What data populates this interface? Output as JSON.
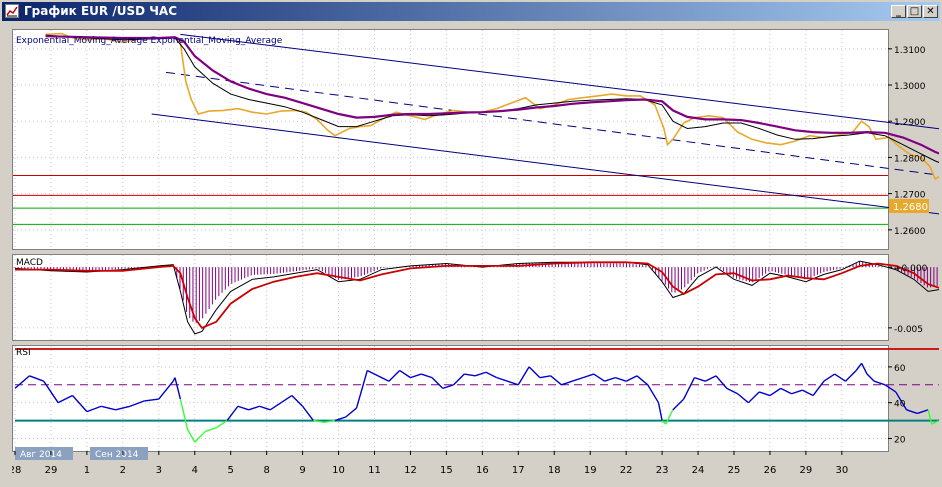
{
  "window": {
    "title": "График EUR /USD  ЧАС",
    "buttons": {
      "minimize": "_",
      "restore": "□",
      "close": "✕"
    }
  },
  "colors": {
    "price": "#e8a82c",
    "ema_fast": "#000000",
    "ema_slow": "#800080",
    "channel": "#000080",
    "resistance": "#cc0000",
    "support": "#00aa00",
    "macd_line": "#000000",
    "macd_signal": "#cc0000",
    "macd_hist": "#800080",
    "rsi_line": "#0000cc",
    "rsi_oversold": "#33ff33",
    "rsi_upper": "#cc0000",
    "rsi_mid": "#800080",
    "rsi_lower": "#008080",
    "price_tag": "#e8a82c"
  },
  "chart_data": [
    {
      "type": "line",
      "panel": "main",
      "title": "Exponential_Moving_Average Exponential_Moving_Average",
      "xlabel": "",
      "ylabel": "",
      "ylim": [
        1.2547,
        1.3152
      ],
      "yticks": [
        "1.3100",
        "1.3000",
        "1.2900",
        "1.2800",
        "1.2700",
        "1.2600"
      ],
      "current_price_label": "1.2680",
      "horizontal_levels": [
        {
          "kind": "resistance",
          "value": 1.275
        },
        {
          "kind": "resistance",
          "value": 1.2695
        },
        {
          "kind": "support",
          "value": 1.266
        },
        {
          "kind": "support",
          "value": 1.2615
        }
      ],
      "channel_lines": [
        {
          "kind": "upper",
          "from": [
            4.6,
            1.314
          ],
          "to": [
            30.5,
            1.282
          ]
        },
        {
          "kind": "middle",
          "from": [
            4.2,
            1.3035
          ],
          "to": [
            30.7,
            1.2685
          ]
        },
        {
          "kind": "lower",
          "from": [
            3.8,
            1.292
          ],
          "to": [
            30.0,
            1.259
          ]
        }
      ],
      "series": [
        {
          "role": "price",
          "x": [
            0.85,
            1.3,
            1.6,
            2,
            2.5,
            3,
            3.5,
            3.9,
            4.1,
            4.45,
            4.6,
            4.65,
            4.75,
            4.9,
            5.1,
            5.4,
            5.8,
            6.2,
            6.6,
            7,
            7.4,
            7.8,
            8.1,
            8.4,
            8.7,
            8.9,
            9.1,
            9.3,
            9.6,
            9.9,
            10.2,
            10.6,
            11,
            11.4,
            11.8,
            12.2,
            12.6,
            13,
            13.4,
            13.8,
            14.2,
            14.6,
            15,
            15.4,
            15.8,
            16.2,
            16.6,
            17,
            17.4,
            17.8,
            18.05,
            18.15,
            18.3,
            18.6,
            18.9,
            19.3,
            19.7,
            20.1,
            20.5,
            20.9,
            21.3,
            21.7,
            22.1,
            22.5,
            22.9,
            23.3,
            23.55,
            23.75,
            23.95,
            24.3,
            24.6,
            24.9,
            25.2,
            25.45,
            25.6,
            25.8,
            26.1,
            26.4,
            26.7,
            26.95,
            27.2,
            27.45,
            27.6
          ],
          "y": [
            1.314,
            1.3142,
            1.313,
            1.3125,
            1.3128,
            1.3118,
            1.3128,
            1.313,
            1.313,
            1.3132,
            1.312,
            1.308,
            1.301,
            1.296,
            1.292,
            1.2928,
            1.293,
            1.2935,
            1.2925,
            1.292,
            1.2928,
            1.293,
            1.2925,
            1.2905,
            1.2875,
            1.286,
            1.287,
            1.288,
            1.2885,
            1.2888,
            1.2905,
            1.2925,
            1.2915,
            1.2905,
            1.292,
            1.293,
            1.2925,
            1.2925,
            1.2935,
            1.295,
            1.2965,
            1.2935,
            1.2945,
            1.296,
            1.2965,
            1.297,
            1.2975,
            1.297,
            1.297,
            1.2945,
            1.288,
            1.2835,
            1.285,
            1.2895,
            1.291,
            1.2915,
            1.291,
            1.287,
            1.285,
            1.284,
            1.2835,
            1.2845,
            1.286,
            1.2855,
            1.2862,
            1.287,
            1.29,
            1.2885,
            1.285,
            1.2855,
            1.283,
            1.2808,
            1.28,
            1.2775,
            1.274,
            1.2755,
            1.276,
            1.2765,
            1.276,
            1.273,
            1.2698,
            1.2688,
            1.269
          ]
        },
        {
          "role": "ema_fast",
          "x": [
            0.85,
            2,
            3,
            4,
            4.45,
            4.7,
            5,
            5.5,
            6,
            6.5,
            7,
            7.5,
            8,
            8.5,
            9,
            9.5,
            10,
            10.5,
            11,
            11.5,
            12,
            12.5,
            13,
            13.5,
            14,
            14.5,
            15,
            15.5,
            16,
            16.5,
            17,
            17.5,
            18,
            18.3,
            18.7,
            19.2,
            19.7,
            20.2,
            20.7,
            21.2,
            21.7,
            22.2,
            22.7,
            23.2,
            23.7,
            24.2,
            24.7,
            25.2,
            25.6,
            26,
            26.4,
            26.8,
            27.2,
            27.6
          ],
          "y": [
            1.3138,
            1.313,
            1.3125,
            1.3128,
            1.313,
            1.31,
            1.305,
            1.3005,
            1.2975,
            1.296,
            1.295,
            1.294,
            1.2925,
            1.2905,
            1.2885,
            1.2885,
            1.29,
            1.2915,
            1.2918,
            1.2915,
            1.2918,
            1.2922,
            1.2925,
            1.2928,
            1.2935,
            1.2945,
            1.295,
            1.2955,
            1.2958,
            1.296,
            1.2962,
            1.296,
            1.2945,
            1.29,
            1.288,
            1.2885,
            1.2895,
            1.2895,
            1.288,
            1.2862,
            1.285,
            1.2852,
            1.2858,
            1.2862,
            1.2868,
            1.286,
            1.2835,
            1.281,
            1.279,
            1.2775,
            1.2768,
            1.2762,
            1.274,
            1.2712
          ]
        },
        {
          "role": "ema_slow",
          "x": [
            0.85,
            2,
            3,
            4,
            4.45,
            4.7,
            5,
            5.5,
            6,
            6.5,
            7,
            7.5,
            8,
            8.5,
            9,
            9.5,
            10,
            10.5,
            11,
            11.5,
            12,
            12.5,
            13,
            13.5,
            14,
            14.5,
            15,
            15.5,
            16,
            16.5,
            17,
            17.5,
            18,
            18.3,
            18.7,
            19.2,
            19.7,
            20.2,
            20.7,
            21.2,
            21.7,
            22.2,
            22.7,
            23.2,
            23.7,
            24.2,
            24.7,
            25.2,
            25.6,
            26,
            26.4,
            26.8,
            27.2,
            27.6
          ],
          "y": [
            1.3135,
            1.3132,
            1.313,
            1.313,
            1.3132,
            1.312,
            1.308,
            1.304,
            1.301,
            1.299,
            1.2975,
            1.2965,
            1.295,
            1.2935,
            1.292,
            1.291,
            1.2912,
            1.2918,
            1.292,
            1.292,
            1.2922,
            1.2924,
            1.2925,
            1.2928,
            1.2932,
            1.2938,
            1.2942,
            1.2948,
            1.2952,
            1.2955,
            1.2958,
            1.296,
            1.2955,
            1.293,
            1.2912,
            1.2905,
            1.2905,
            1.2903,
            1.2895,
            1.2885,
            1.2875,
            1.287,
            1.2868,
            1.2868,
            1.287,
            1.2868,
            1.2855,
            1.2835,
            1.2815,
            1.28,
            1.279,
            1.278,
            1.2765,
            1.2742
          ]
        }
      ]
    },
    {
      "type": "line",
      "panel": "macd",
      "title": "MACD",
      "ylim": [
        -0.006,
        0.001
      ],
      "yticks": [
        "+0.000",
        "-0.005"
      ],
      "series": [
        {
          "role": "macd_line",
          "x": [
            0,
            1,
            2,
            3,
            4,
            4.4,
            4.6,
            4.8,
            5.0,
            5.2,
            5.6,
            6,
            6.6,
            7.2,
            7.8,
            8.4,
            9,
            9.6,
            10.2,
            11,
            12,
            13,
            14,
            15,
            16,
            17,
            17.6,
            18,
            18.3,
            18.6,
            19,
            19.5,
            20,
            20.5,
            21,
            21.5,
            22,
            22.5,
            23,
            23.5,
            24,
            24.5,
            25,
            25.4,
            25.8,
            26.2,
            26.6,
            27,
            27.4,
            27.6
          ],
          "y": [
            -0.0001,
            -0.0003,
            -0.0004,
            -0.0002,
            0.0001,
            0.0002,
            -0.002,
            -0.0045,
            -0.0055,
            -0.0053,
            -0.0035,
            -0.002,
            -0.001,
            -0.0008,
            -0.0005,
            -0.0002,
            -0.0012,
            -0.001,
            -0.0002,
            0.0001,
            0.0003,
            0.0,
            0.0003,
            0.0004,
            0.0004,
            0.0004,
            0.0002,
            -0.0012,
            -0.0025,
            -0.0022,
            -0.0008,
            0.0,
            -0.001,
            -0.0015,
            -0.0005,
            -0.0008,
            -0.0012,
            -0.0006,
            -0.0002,
            0.0005,
            0.0002,
            -0.0002,
            -0.001,
            -0.002,
            -0.0018,
            -0.0008,
            -0.0004,
            -0.0005,
            -0.0015,
            -0.0016
          ]
        },
        {
          "role": "macd_signal",
          "x": [
            0,
            1,
            2,
            3,
            4,
            4.4,
            4.6,
            4.8,
            5.0,
            5.2,
            5.6,
            6,
            6.6,
            7.2,
            7.8,
            8.4,
            9,
            9.6,
            10.2,
            11,
            12,
            13,
            14,
            15,
            16,
            17,
            17.6,
            18,
            18.3,
            18.6,
            19,
            19.5,
            20,
            20.5,
            21,
            21.5,
            22,
            22.5,
            23,
            23.5,
            24,
            24.5,
            25,
            25.4,
            25.8,
            26.2,
            26.6,
            27,
            27.4,
            27.6
          ],
          "y": [
            -0.0002,
            -0.0002,
            -0.0003,
            -0.0003,
            0.0,
            0.0001,
            -0.0005,
            -0.0025,
            -0.0042,
            -0.005,
            -0.0045,
            -0.003,
            -0.0018,
            -0.0012,
            -0.0008,
            -0.0005,
            -0.0008,
            -0.0011,
            -0.0006,
            -0.0001,
            0.0001,
            0.0001,
            0.0001,
            0.0003,
            0.0004,
            0.0004,
            0.0003,
            -0.0004,
            -0.0016,
            -0.0022,
            -0.0016,
            -0.0006,
            -0.0005,
            -0.0011,
            -0.001,
            -0.0007,
            -0.0009,
            -0.001,
            -0.0005,
            0.0001,
            0.0003,
            0.0001,
            -0.0005,
            -0.0014,
            -0.0018,
            -0.0014,
            -0.0008,
            -0.0005,
            -0.001,
            -0.0015
          ]
        }
      ]
    },
    {
      "type": "line",
      "panel": "rsi",
      "title": "RSI",
      "ylim": [
        13,
        70
      ],
      "yticks": [
        "60",
        "40",
        "20"
      ],
      "levels": {
        "upper": 70,
        "mid": 50,
        "lower": 30
      },
      "series": [
        {
          "role": "rsi",
          "x": [
            0,
            0.4,
            0.8,
            1.2,
            1.6,
            2,
            2.4,
            2.8,
            3.2,
            3.6,
            4,
            4.4,
            4.45,
            4.6,
            4.8,
            5.0,
            5.3,
            5.6,
            5.9,
            6.2,
            6.5,
            6.8,
            7.1,
            7.4,
            7.7,
            8.0,
            8.3,
            8.6,
            8.9,
            9.2,
            9.5,
            9.8,
            10.1,
            10.4,
            10.7,
            11,
            11.3,
            11.6,
            11.9,
            12.2,
            12.5,
            12.8,
            13.1,
            13.4,
            13.7,
            14,
            14.3,
            14.6,
            14.9,
            15.2,
            15.5,
            15.8,
            16.1,
            16.4,
            16.7,
            17,
            17.3,
            17.6,
            17.9,
            18.0,
            18.1,
            18.3,
            18.6,
            18.9,
            19.2,
            19.5,
            19.8,
            20.1,
            20.4,
            20.7,
            21,
            21.3,
            21.6,
            21.9,
            22.2,
            22.5,
            22.8,
            23.1,
            23.4,
            23.55,
            23.7,
            23.9,
            24.2,
            24.5,
            24.8,
            25.1,
            25.4,
            25.5,
            25.7,
            26,
            26.3,
            26.6,
            26.9,
            27.2,
            27.5,
            27.6
          ],
          "y": [
            48,
            55,
            52,
            40,
            44,
            35,
            38,
            36,
            38,
            41,
            42,
            52,
            54,
            42,
            25,
            18,
            24,
            26,
            30,
            38,
            36,
            38,
            36,
            40,
            44,
            38,
            30,
            29,
            30,
            32,
            37,
            58,
            55,
            52,
            58,
            54,
            56,
            54,
            48,
            50,
            56,
            55,
            57,
            54,
            52,
            50,
            60,
            54,
            55,
            50,
            52,
            54,
            56,
            52,
            54,
            52,
            55,
            50,
            40,
            30,
            28,
            36,
            42,
            54,
            52,
            55,
            48,
            45,
            40,
            46,
            44,
            48,
            45,
            47,
            44,
            52,
            56,
            52,
            58,
            62,
            56,
            52,
            50,
            46,
            36,
            34,
            36,
            28,
            30,
            40,
            36,
            42,
            44,
            40,
            32,
            31
          ]
        }
      ]
    }
  ],
  "time_axis": {
    "labels": [
      "28",
      "29",
      "1",
      "2",
      "3",
      "4",
      "5",
      "8",
      "9",
      "10",
      "11",
      "12",
      "15",
      "16",
      "17",
      "18",
      "19",
      "22",
      "23",
      "24",
      "25",
      "26",
      "29",
      "30"
    ],
    "month_labels": [
      "Авг 2014",
      "Сен 2014"
    ]
  }
}
